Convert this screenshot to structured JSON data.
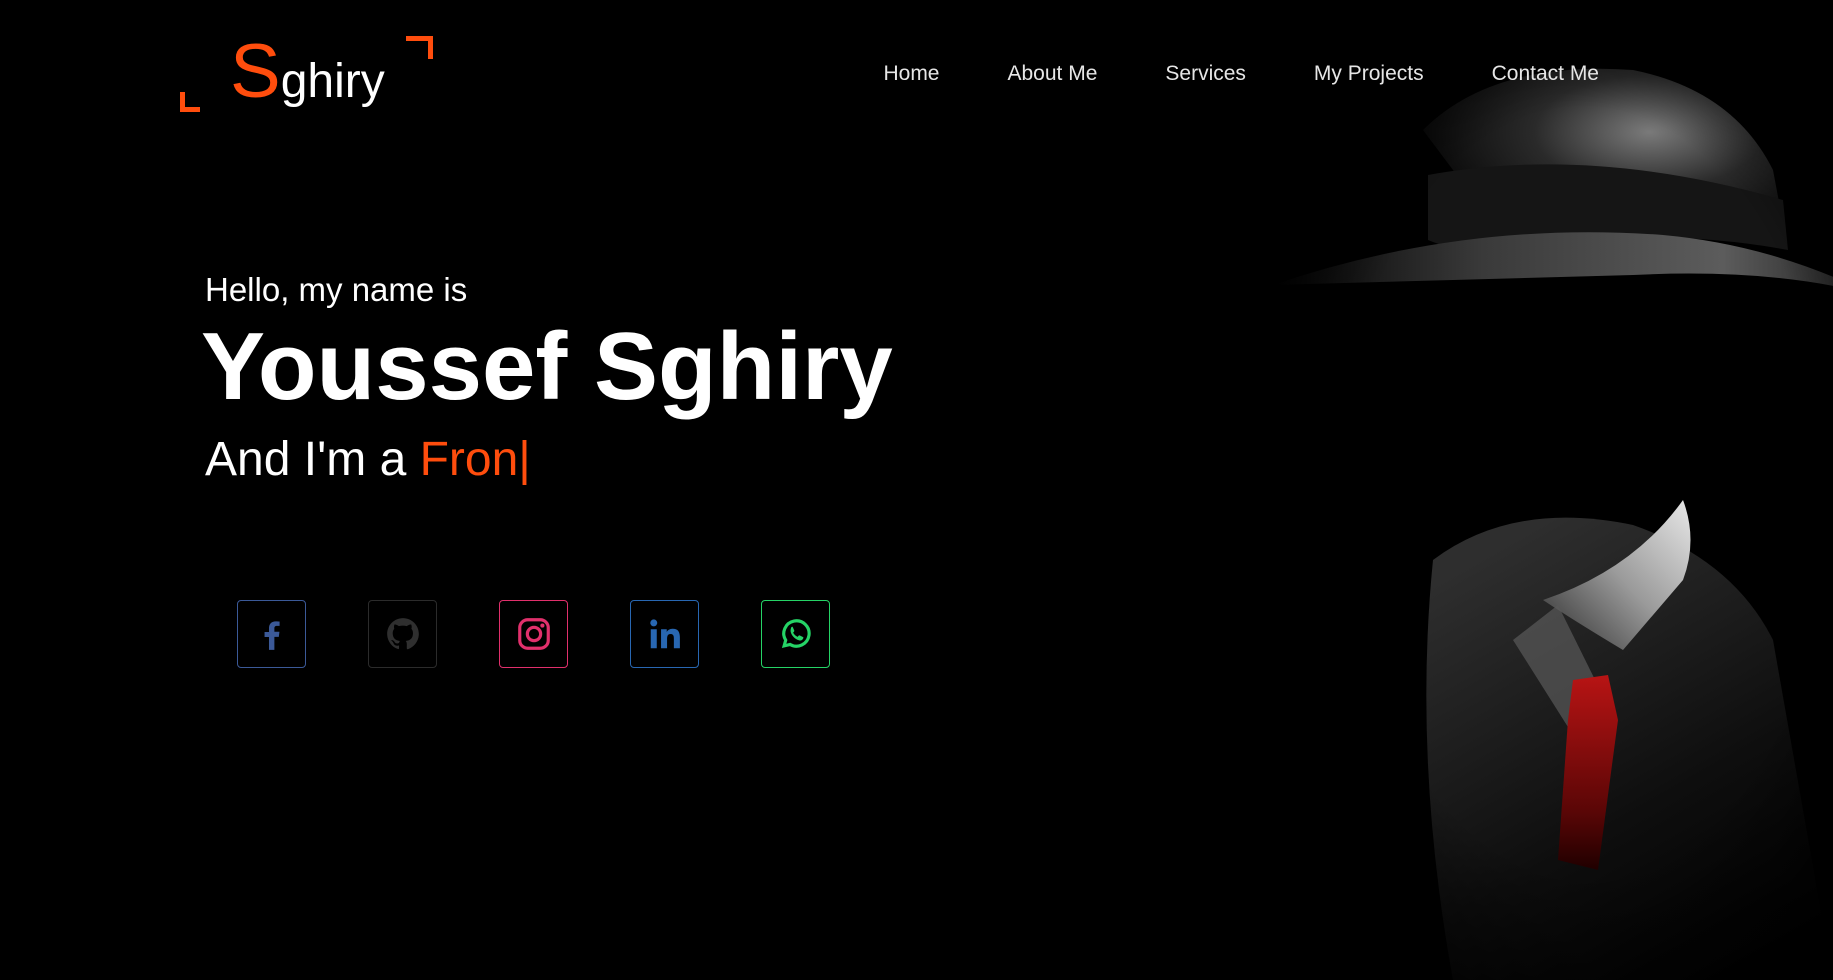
{
  "logo": {
    "initial": "S",
    "rest": "ghiry"
  },
  "nav": {
    "items": [
      {
        "label": "Home"
      },
      {
        "label": "About Me"
      },
      {
        "label": "Services"
      },
      {
        "label": "My Projects"
      },
      {
        "label": "Contact Me"
      }
    ]
  },
  "hero": {
    "greeting": "Hello, my name is",
    "name": "Youssef Sghiry",
    "role_prefix": "And I'm a ",
    "role_typed": "Fron",
    "cursor": "|"
  },
  "socials": [
    {
      "icon": "facebook-icon",
      "color": "#3b5998"
    },
    {
      "icon": "github-icon",
      "color": "#2b2b2b"
    },
    {
      "icon": "instagram-icon",
      "color": "#e1306c"
    },
    {
      "icon": "linkedin-icon",
      "color": "#2867b2"
    },
    {
      "icon": "whatsapp-icon",
      "color": "#25d366"
    }
  ],
  "colors": {
    "accent": "#ff4d0d",
    "background": "#000000",
    "text": "#ffffff"
  }
}
